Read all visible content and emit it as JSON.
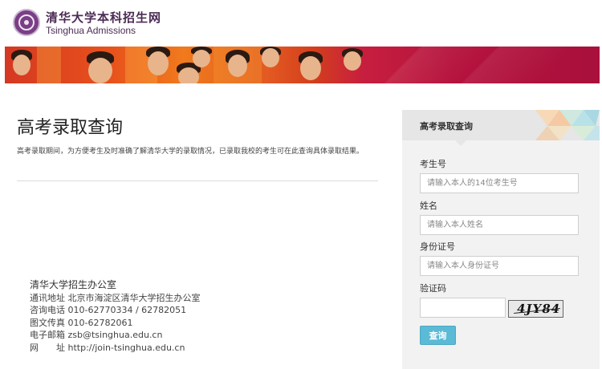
{
  "header": {
    "brand_cn": "清华大学本科招生网",
    "brand_en": "Tsinghua Admissions",
    "logo_icon": "tsinghua-seal-icon"
  },
  "main": {
    "title": "高考录取查询",
    "intro": "高考录取期间，为方便考生及时准确了解清华大学的录取情况，已录取我校的考生可在此查询具体录取结果。"
  },
  "contact": {
    "org": "清华大学招生办公室",
    "address": "通讯地址 北京市海淀区清华大学招生办公室",
    "phone": "咨询电话 010-62770334 / 62782051",
    "fax": "图文传真 010-62782061",
    "email": "电子邮箱 zsb@tsinghua.edu.cn",
    "website": "网　　址 http://join-tsinghua.edu.cn"
  },
  "form": {
    "title": "高考录取查询",
    "exam_no_label": "考生号",
    "exam_no_placeholder": "请输入本人的14位考生号",
    "name_label": "姓名",
    "name_placeholder": "请输入本人姓名",
    "id_label": "身份证号",
    "id_placeholder": "请输入本人身份证号",
    "captcha_label": "验证码",
    "captcha_text": "4JY84",
    "submit_label": "查询"
  },
  "colors": {
    "brand_purple": "#4b2c55",
    "button": "#5bbad5",
    "banner_red": "#b5123d",
    "banner_orange": "#f07a1d"
  }
}
